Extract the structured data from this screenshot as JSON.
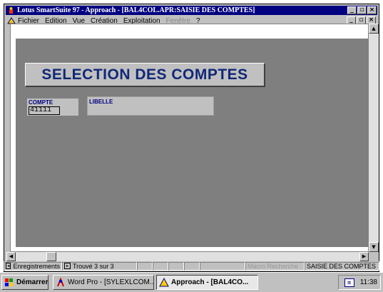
{
  "window": {
    "title": "Lotus SmartSuite 97   - Approach - [BAL4COL.APR:SAISIE DES COMPTES]",
    "controls": {
      "minimize": "_",
      "maximize": "▫",
      "close": "×"
    }
  },
  "menubar": {
    "items": [
      {
        "label": "Fichier",
        "enabled": true
      },
      {
        "label": "Edition",
        "enabled": true
      },
      {
        "label": "Vue",
        "enabled": true
      },
      {
        "label": "Création",
        "enabled": true
      },
      {
        "label": "Exploitation",
        "enabled": true
      },
      {
        "label": "Fenêtre",
        "enabled": false
      },
      {
        "label": "?",
        "enabled": true
      }
    ]
  },
  "form": {
    "title": "SELECTION DES COMPTES",
    "compte": {
      "label": "COMPTE",
      "value": "41111"
    },
    "libelle": {
      "label": "LIBELLE",
      "value": ""
    }
  },
  "statusbar": {
    "mode": "Enregistrements",
    "record_info": "Trouvé 3 sur 3",
    "macro": "Macro Recherche",
    "form_name": "SAISIE DES COMPTES"
  },
  "taskbar": {
    "start": "Démarrer",
    "tasks": [
      {
        "label": "Word Pro - [SYLEXLCOM...",
        "active": false
      },
      {
        "label": "Approach - [BAL4CO...",
        "active": true
      }
    ],
    "clock": "11:38"
  },
  "colors": {
    "title_bar": "#000080",
    "form_background": "#7f7f7f",
    "header_text": "#102878",
    "field_label": "#000080"
  }
}
